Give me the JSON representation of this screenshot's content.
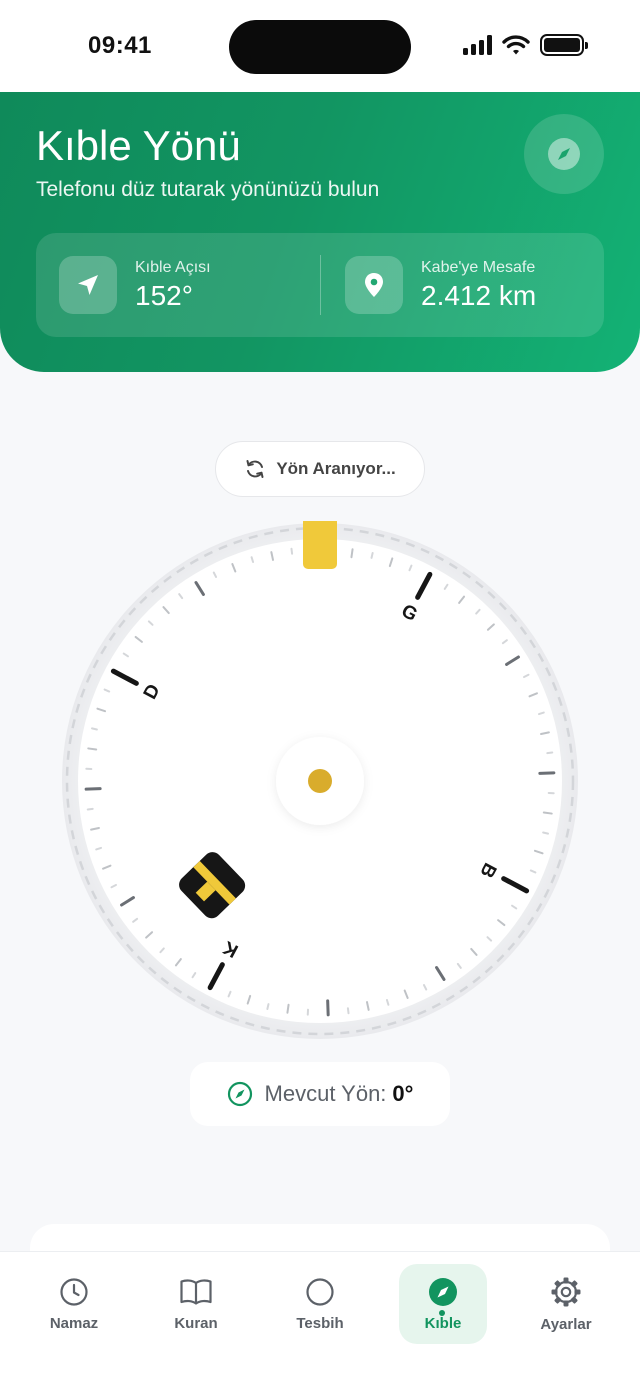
{
  "status_bar": {
    "time": "09:41"
  },
  "header": {
    "title": "Kıble Yönü",
    "subtitle": "Telefonu düz tutarak yönünüzü bulun",
    "stats": [
      {
        "label": "Kıble Açısı",
        "value": "152°",
        "icon": "navigation-arrow-icon"
      },
      {
        "label": "Kabe'ye Mesafe",
        "value": "2.412 km",
        "icon": "map-pin-icon"
      }
    ]
  },
  "search_status": {
    "label": "Yön Aranıyor...",
    "icon": "refresh-icon"
  },
  "compass": {
    "cardinals": {
      "north": "K",
      "east": "D",
      "south": "G",
      "west": "B"
    },
    "qibla_angle_deg": 152,
    "colors": {
      "accent": "#12945f",
      "qibla_marker": "#f0c93a",
      "center_dot": "#d9ac2c"
    }
  },
  "current_direction": {
    "label": "Mevcut Yön:",
    "value": "0°"
  },
  "nav": {
    "items": [
      {
        "label": "Namaz",
        "icon": "clock-icon"
      },
      {
        "label": "Kuran",
        "icon": "book-icon"
      },
      {
        "label": "Tesbih",
        "icon": "circle-icon"
      },
      {
        "label": "Kıble",
        "icon": "compass-icon",
        "active": true
      },
      {
        "label": "Ayarlar",
        "icon": "gear-icon"
      }
    ]
  }
}
